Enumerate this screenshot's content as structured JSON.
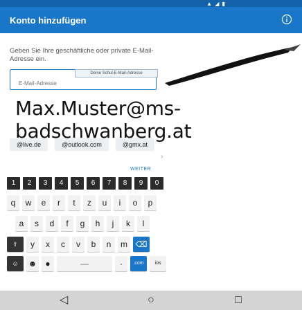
{
  "app_bar": {
    "title": "Konto hinzufügen"
  },
  "form": {
    "description": "Geben Sie Ihre geschäftliche oder private E-Mail-Adresse ein.",
    "input_placeholder": "E-Mail-Adresse",
    "tooltip": "Deine Schul-E-Mail-Adresse"
  },
  "handwritten_email": "Max.Muster@ms-badschwanberg.at",
  "domain_suggestions": [
    "@live.de",
    "@outlook.com",
    "@gmx.at"
  ],
  "next_label": "WEITER",
  "keyboard": {
    "number_row": [
      "1",
      "2",
      "3",
      "4",
      "5",
      "6",
      "7",
      "8",
      "9",
      "0"
    ],
    "row1": [
      "q",
      "w",
      "e",
      "r",
      "t",
      "z",
      "u",
      "i",
      "o",
      "p"
    ],
    "row2": [
      "a",
      "s",
      "d",
      "f",
      "g",
      "h",
      "j",
      "k",
      "l"
    ],
    "row3": [
      "y",
      "x",
      "c",
      "v",
      "b",
      "n",
      "m"
    ],
    "bottom": {
      "space": "—",
      "com": ".com",
      "ios": "ios"
    }
  },
  "colors": {
    "primary": "#1976c8",
    "status": "#1463a8",
    "nav": "#d4d4d4"
  },
  "icons": {
    "info": "info-icon",
    "pen": "pen-icon",
    "shift": "shift-icon",
    "backspace": "backspace-icon",
    "back": "back-triangle-icon",
    "home": "home-circle-icon",
    "recents": "recents-square-icon"
  }
}
